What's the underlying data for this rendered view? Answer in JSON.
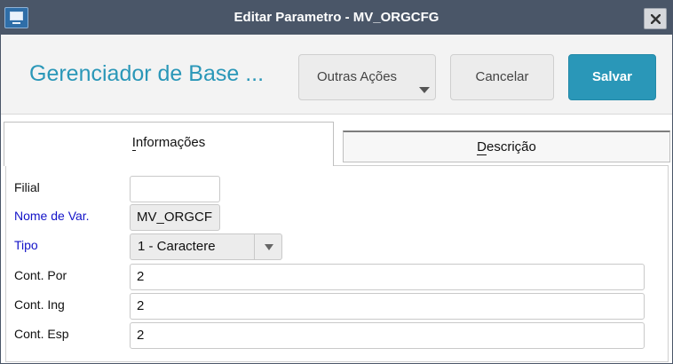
{
  "window": {
    "title": "Editar Parametro - MV_ORGCFG",
    "app_icon": "monitor-icon",
    "close_icon": "close-icon"
  },
  "header": {
    "title": "Gerenciador de Base ...",
    "buttons": {
      "outras": "Outras Ações",
      "cancelar": "Cancelar",
      "salvar": "Salvar"
    }
  },
  "tabs": {
    "info_first": "I",
    "info_rest": "nformações",
    "desc_first": "D",
    "desc_rest": "escrição",
    "active": "Informações"
  },
  "form": {
    "filial": {
      "label": "Filial",
      "value": ""
    },
    "nome_var": {
      "label": "Nome de Var.",
      "value": "MV_ORGCF"
    },
    "tipo": {
      "label": "Tipo",
      "value": "1 - Caractere"
    },
    "cont_por": {
      "label": "Cont. Por",
      "value": "2"
    },
    "cont_ing": {
      "label": "Cont. Ing",
      "value": "2"
    },
    "cont_esp": {
      "label": "Cont. Esp",
      "value": "2"
    }
  },
  "colors": {
    "titlebar": "#4a5668",
    "accent": "#2a97b8",
    "required_label": "#1313c8"
  }
}
